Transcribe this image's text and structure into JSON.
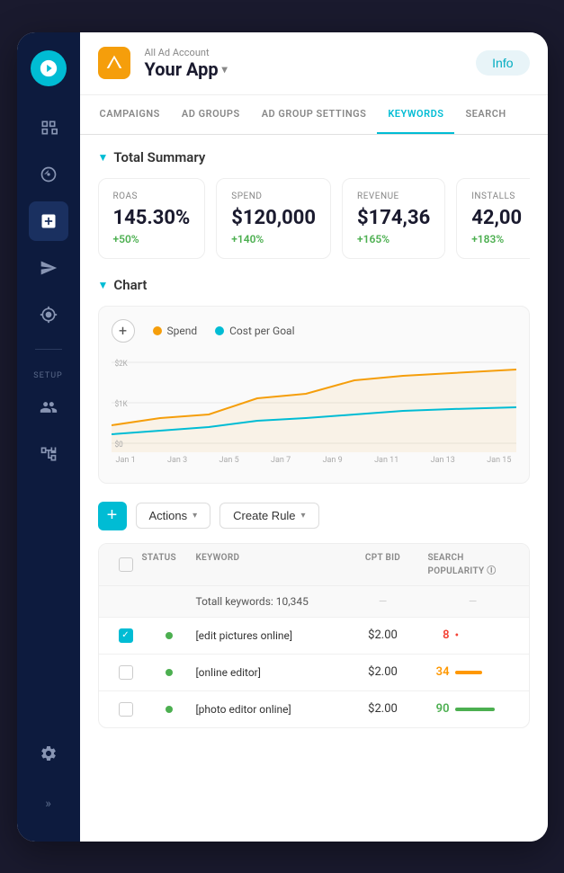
{
  "header": {
    "all_ad_label": "All Ad Account",
    "app_name": "Your App",
    "chevron": "▾",
    "info_btn": "Info"
  },
  "nav_tabs": [
    {
      "id": "campaigns",
      "label": "CAMPAIGNS",
      "active": false
    },
    {
      "id": "ad-groups",
      "label": "AD GROUPS",
      "active": false
    },
    {
      "id": "ad-group-settings",
      "label": "AD GROUP SETTINGS",
      "active": false
    },
    {
      "id": "keywords",
      "label": "KEYWORDS",
      "active": true
    },
    {
      "id": "search",
      "label": "SEARCH",
      "active": false
    }
  ],
  "total_summary": {
    "section_label": "Total Summary",
    "cards": [
      {
        "label": "ROAS",
        "value": "145.30%",
        "change": "+50%",
        "positive": true
      },
      {
        "label": "Spend",
        "value": "$120,000",
        "change": "+140%",
        "positive": true
      },
      {
        "label": "Revenue",
        "value": "$174,36",
        "change": "+165%",
        "positive": true
      },
      {
        "label": "Installs",
        "value": "42,00",
        "change": "+183%",
        "positive": true
      }
    ]
  },
  "chart": {
    "section_label": "Chart",
    "add_icon": "+",
    "legend": [
      {
        "label": "Spend",
        "color": "#f59e0b"
      },
      {
        "label": "Cost per Goal",
        "color": "#00bcd4"
      }
    ],
    "y_labels": [
      "$2K",
      "$1K",
      "$0"
    ],
    "x_labels": [
      "Jan 1",
      "Jan 3",
      "Jan 5",
      "Jan 7",
      "Jan 9",
      "Jan 11",
      "Jan 13",
      "Jan 15"
    ]
  },
  "actions_bar": {
    "add_icon": "+",
    "actions_label": "Actions",
    "actions_arrow": "▾",
    "create_rule_label": "Create Rule",
    "create_rule_arrow": "▾"
  },
  "table": {
    "headers": [
      "",
      "Status",
      "Keyword",
      "CPT Bid",
      "Search Popularity ⓘ"
    ],
    "total_row": {
      "label": "Totall keywords: 10,345"
    },
    "rows": [
      {
        "checked": true,
        "status": "active",
        "keyword": "[edit pictures online]",
        "bid": "$2.00",
        "popularity": "8",
        "popularity_color": "red",
        "bar_color": "#f44336",
        "bar_type": "dot"
      },
      {
        "checked": false,
        "status": "active",
        "keyword": "[online editor]",
        "bid": "$2.00",
        "popularity": "34",
        "popularity_color": "orange",
        "bar_color": "#ff9800",
        "bar_type": "bar"
      },
      {
        "checked": false,
        "status": "active",
        "keyword": "[photo editor online]",
        "bid": "$2.00",
        "popularity": "90",
        "popularity_color": "green",
        "bar_color": "#4caf50",
        "bar_type": "bar"
      }
    ]
  },
  "sidebar": {
    "logo_letter": "",
    "icons": [
      {
        "id": "dashboard",
        "symbol": "⊕",
        "active": false
      },
      {
        "id": "campaigns-nav",
        "symbol": "◎",
        "active": false
      },
      {
        "id": "add-creative",
        "symbol": "⊞",
        "active": true
      },
      {
        "id": "send",
        "symbol": "✉",
        "active": false
      },
      {
        "id": "target",
        "symbol": "⊕",
        "active": false
      }
    ],
    "setup_label": "SETUP",
    "setup_icons": [
      {
        "id": "users",
        "symbol": "👥",
        "active": false
      },
      {
        "id": "tree",
        "symbol": "⋮⋮",
        "active": false
      }
    ],
    "bottom_icons": [
      {
        "id": "settings",
        "symbol": "⚙",
        "active": false
      },
      {
        "id": "expand",
        "symbol": "»",
        "active": false
      }
    ]
  }
}
